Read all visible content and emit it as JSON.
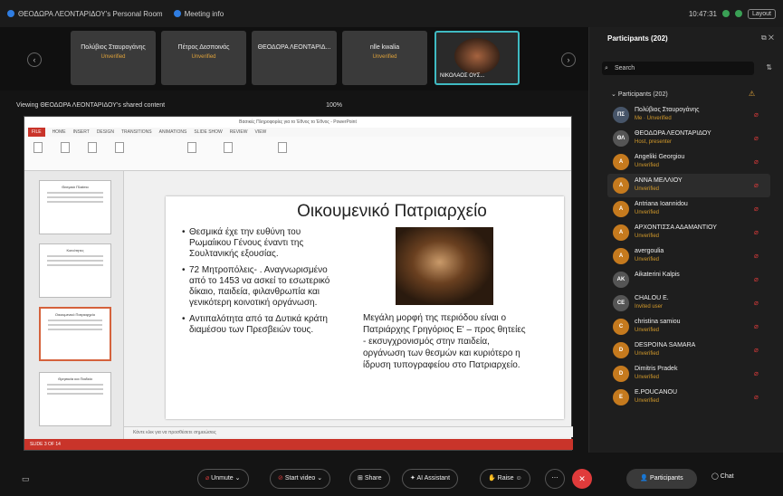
{
  "topbar": {
    "title": "ΘΕΟΔΩΡΑ ΛΕΟΝΤΑΡΙΔΟΥ's Personal Room",
    "meeting_info": "Meeting info",
    "time": "10:47:31",
    "layout": "Layout"
  },
  "tiles": [
    {
      "name": "Πολύβιος Σταυρογάνης",
      "status": "Unverified"
    },
    {
      "name": "Πέτρος Δεσποινάς",
      "status": "Unverified"
    },
    {
      "name": "ΘΕΟΔΩΡΑ ΛΕΟΝΤΑΡΙΔ...",
      "status": ""
    },
    {
      "name": "nlle kwalia",
      "status": "Unverified"
    },
    {
      "name": "ΝΙΚΟΛΑΟΣ ΟΥΣ...",
      "status": ""
    }
  ],
  "share": {
    "viewing": "Viewing ΘΕΟΔΩΡΑ ΛΕΟΝΤΑΡΙΔΟΥ's shared content",
    "zoom": "100%"
  },
  "ppt": {
    "window_title": "Βασικές Πληροφορίες για το Έθνος το Έθνος - PowerPoint",
    "tabs": [
      "FILE",
      "HOME",
      "INSERT",
      "DESIGN",
      "TRANSITIONS",
      "ANIMATIONS",
      "SLIDE SHOW",
      "REVIEW",
      "VIEW"
    ],
    "thumb_titles": [
      "Θεσμικό Πλαίσιο",
      "Κοινότητες",
      "Οικουμενικό Πατριαρχείο",
      "Θρησκεία και Παιδεία"
    ],
    "notes": "Κάντε κλικ για να προσθέσετε σημειώσεις",
    "status": "SLIDE 3 OF 14"
  },
  "slide": {
    "title": "Οικουμενικό Πατριαρχείο",
    "bullets": [
      "Θεσμικά έχε την ευθύνη του Ρωμαίικου Γένους έναντι της Σουλτανικής εξουσίας.",
      "72 Μητροπόλεις- . Αναγνωρισμένο από το 1453 να ασκεί το εσωτερικό δίκαιο, παιδεία, φιλανθρωπία και γενικότερη κοινοτική οργάνωση.",
      "Αντιπαλότητα από τα Δυτικά κράτη διαμέσου των Πρεσβειών τους."
    ],
    "caption": "Μεγάλη μορφή της περιόδου είναι ο Πατριάρχης Γρηγόριος Ε' – προς θητείες - εκσυγχρονισμός στην παιδεία, οργάνωση των θεσμών και κυριότερο η ίδρυση τυπογραφείου στο Πατριαρχείο."
  },
  "panel": {
    "title": "Participants (202)",
    "search_placeholder": "Search",
    "group_label": "Participants (202)",
    "participants": [
      {
        "initials": "ΠΣ",
        "name": "Πολύβιος Σταυρογάνης",
        "status": "Me · Unverified",
        "color": "teal"
      },
      {
        "initials": "ΘΛ",
        "name": "ΘΕΟΔΩΡΑ ΛΕΟΝΤΑΡΙΔΟΥ",
        "status": "Host, presenter",
        "color": "gy"
      },
      {
        "initials": "A",
        "name": "Angeliki Georgiou",
        "status": "Unverified",
        "color": "or"
      },
      {
        "initials": "A",
        "name": "ΑΝΝΑ ΜΕΛΛΙΟΥ",
        "status": "Unverified",
        "color": "or"
      },
      {
        "initials": "A",
        "name": "Antriana Ioannidou",
        "status": "Unverified",
        "color": "or"
      },
      {
        "initials": "A",
        "name": "ΑΡΧΟΝΤΙΣΣΑ ΑΔΑΜΑΝΤΙΟΥ",
        "status": "Unverified",
        "color": "or"
      },
      {
        "initials": "A",
        "name": "avergoulia",
        "status": "Unverified",
        "color": "or"
      },
      {
        "initials": "AK",
        "name": "Aikaterini Kalpis",
        "status": "",
        "color": "gy"
      },
      {
        "initials": "CE",
        "name": "CHALOU E.",
        "status": "Invited user",
        "color": "gy"
      },
      {
        "initials": "C",
        "name": "christina samiou",
        "status": "Unverified",
        "color": "or"
      },
      {
        "initials": "D",
        "name": "DESPOINA SAMARA",
        "status": "Unverified",
        "color": "or"
      },
      {
        "initials": "D",
        "name": "Dimitris Pradek",
        "status": "Unverified",
        "color": "or"
      },
      {
        "initials": "E",
        "name": "E.POUCANOU",
        "status": "Unverified",
        "color": "or"
      }
    ]
  },
  "bottom": {
    "unmute": "Unmute",
    "start_video": "Start video",
    "share": "Share",
    "ai": "AI Assistant",
    "raise": "Raise",
    "participants": "Participants",
    "chat": "Chat"
  }
}
